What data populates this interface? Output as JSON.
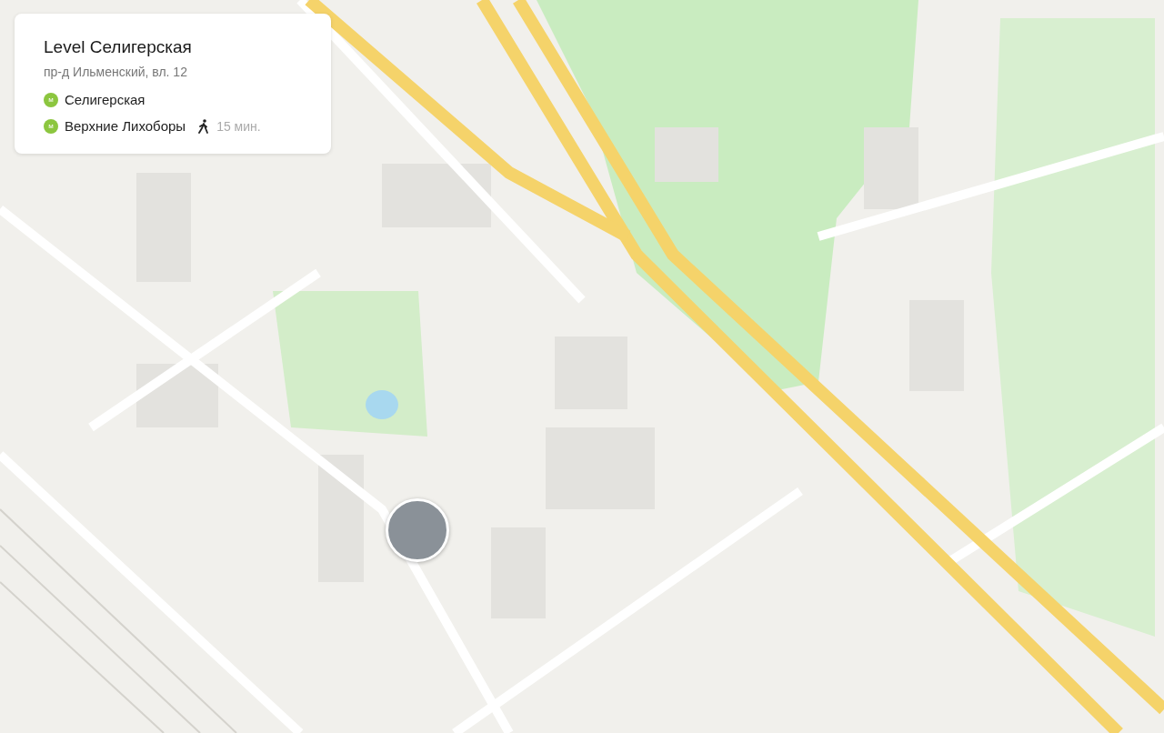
{
  "place_card": {
    "title": "Level Селигерская",
    "address": "пр-д Ильменский, вл. 12",
    "metro_stations": [
      {
        "badge": "м",
        "name": "Селигерская"
      },
      {
        "badge": "м",
        "name": "Верхние Лихоборы",
        "walk_time": "15 мин."
      }
    ]
  }
}
